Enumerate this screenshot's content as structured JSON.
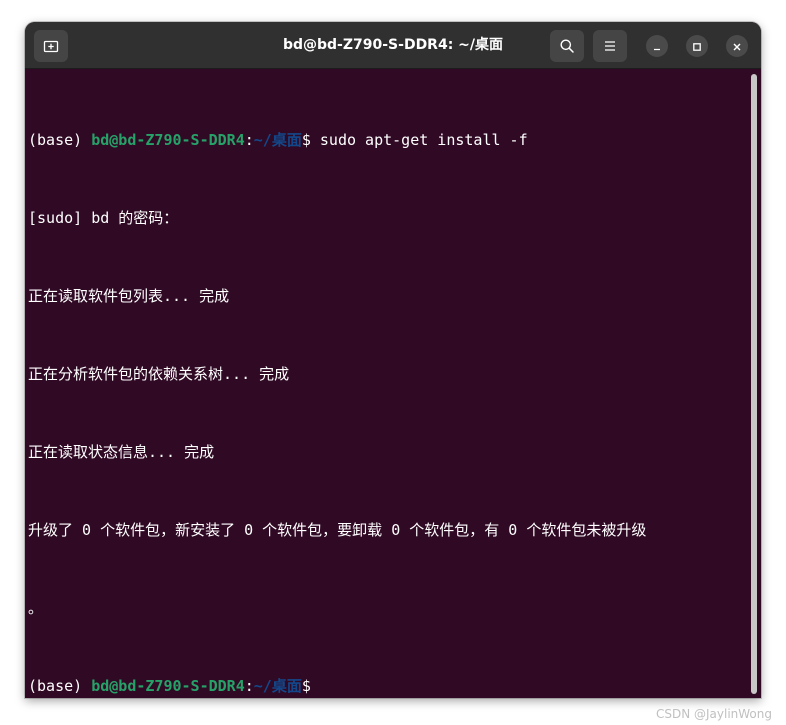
{
  "window": {
    "title": "bd@bd-Z790-S-DDR4: ~/桌面"
  },
  "toolbar": {
    "new_tab_icon": "new-tab-icon",
    "search_icon": "search-icon",
    "menu_icon": "hamburger-menu-icon",
    "minimize_icon": "minimize-icon",
    "maximize_icon": "maximize-icon",
    "close_icon": "close-icon"
  },
  "terminal": {
    "line1": {
      "env": "(base) ",
      "user": "bd@bd-Z790-S-DDR4",
      "colon": ":",
      "path": "~/桌面",
      "dollar": "$ ",
      "command": "sudo apt-get install -f"
    },
    "line2": "[sudo] bd 的密码：",
    "line3": "正在读取软件包列表... 完成",
    "line4": "正在分析软件包的依赖关系树... 完成",
    "line5": "正在读取状态信息... 完成",
    "line6": "升级了 0 个软件包，新安装了 0 个软件包，要卸载 0 个软件包，有 0 个软件包未被升级",
    "line7": "。",
    "line8": {
      "env": "(base) ",
      "user": "bd@bd-Z790-S-DDR4",
      "colon": ":",
      "path": "~/桌面",
      "dollar": "$ "
    }
  },
  "colors": {
    "terminal_bg": "#300a24",
    "titlebar_bg": "#303030",
    "prompt_user": "#26a269",
    "prompt_path": "#12488b"
  },
  "watermark": "CSDN @JaylinWong"
}
